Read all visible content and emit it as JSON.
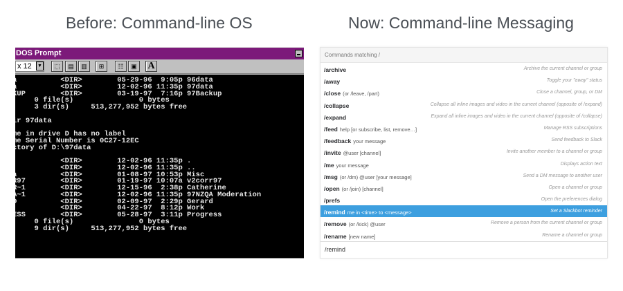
{
  "headings": {
    "before": "Before: Command-line OS",
    "now": "Now: Command-line Messaging"
  },
  "dos": {
    "title": "DOS Prompt",
    "font_size": "x 12",
    "font_dropdown_icon": "chevron-down-icon",
    "toolbar_icons": [
      "mark-icon",
      "copy-icon",
      "paste-icon",
      "fullscreen-icon",
      "properties-icon",
      "background-icon",
      "font-icon"
    ],
    "font_button_label": "A",
    "lines": [
      "a          <DIR>        05-29-96  9:05p 96data",
      "a          <DIR>        12-02-96 11:35p 97data",
      "KUP        <DIR>        03-19-97  7:16p 97Backup",
      "     0 file(s)               0 bytes",
      "     3 dir(s)     513,277,952 bytes free",
      "",
      "ir 97data",
      "",
      "me in drive D has no label",
      "me Serial Number is 0C27-12EC",
      "ctory of D:\\97data",
      "",
      "           <DIR>        12-02-96 11:35p .",
      "           <DIR>        12-02-96 11:35p ..",
      "a          <DIR>        01-08-97 10:53p Misc",
      "R97        <DIR>        01-19-97 10:07a v2corr97",
      "R~1        <DIR>        12-15-96  2:38p Catherine",
      "A~1        <DIR>        12-02-96 11:35p 97NZQA Moderation",
      "D          <DIR>        02-09-97  2:29p Gerard",
      "           <DIR>        04-22-97  8:12p Work",
      "ESS        <DIR>        05-28-97  3:11p Progress",
      "     0 file(s)               0 bytes",
      "     9 dir(s)     513,277,952 bytes free"
    ]
  },
  "slack": {
    "header": "Commands matching /",
    "commands": [
      {
        "name": "/archive",
        "args": "",
        "desc": "Archive the current channel or group"
      },
      {
        "name": "/away",
        "args": "",
        "desc": "Toggle your \"away\" status"
      },
      {
        "name": "/close",
        "args": "(or /leave, /part)",
        "desc": "Close a channel, group, or DM"
      },
      {
        "name": "/collapse",
        "args": "",
        "desc": "Collapse all inline images and video in the current channel (opposite of /expand)"
      },
      {
        "name": "/expand",
        "args": "",
        "desc": "Expand all inline images and video in the current channel (opposite of /collapse)"
      },
      {
        "name": "/feed",
        "args": "help [or subscribe, list, remove…]",
        "desc": "Manage RSS subscriptions"
      },
      {
        "name": "/feedback",
        "args": "your message",
        "desc": "Send feedback to Slack"
      },
      {
        "name": "/invite",
        "args": "@user [channel]",
        "desc": "Invite another member to a channel or group"
      },
      {
        "name": "/me",
        "args": "your message",
        "desc": "Displays action text"
      },
      {
        "name": "/msg",
        "args": "(or /dm) @user [your message]",
        "desc": "Send a DM message to another user"
      },
      {
        "name": "/open",
        "args": "(or /join) [channel]",
        "desc": "Open a channel or group"
      },
      {
        "name": "/prefs",
        "args": "",
        "desc": "Open the preferences dialog"
      },
      {
        "name": "/remind",
        "args": "me in <time> to <message>",
        "desc": "Set a Slackbot reminder",
        "selected": true
      },
      {
        "name": "/remove",
        "args": "(or /kick) @user",
        "desc": "Remove a person from the current channel or group"
      },
      {
        "name": "/rename",
        "args": "[new name]",
        "desc": "Rename a channel or group"
      }
    ],
    "input_value": "/remind",
    "selected_color": "#3d9fdf"
  }
}
